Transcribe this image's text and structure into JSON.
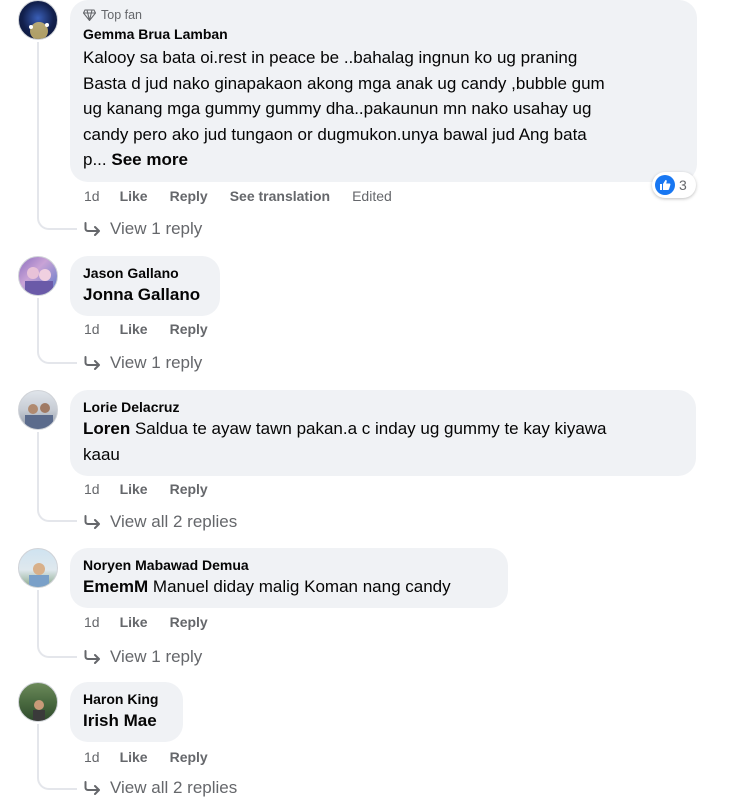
{
  "comments": [
    {
      "badge": "Top fan",
      "author": "Gemma Brua Lamban",
      "text_lines": [
        "Kalooy sa bata oi.rest in peace be ..bahalag ingnun ko ug praning",
        "Basta d jud nako ginapakaon akong mga anak ug candy ,bubble gum",
        "ug kanang mga gummy gummy dha..pakaunun mn nako usahay ug",
        "candy pero ako jud tungaon or dugmukon.unya bawal jud Ang bata"
      ],
      "text_last": "p...",
      "see_more": "See more",
      "time": "1d",
      "like": "Like",
      "reply": "Reply",
      "see_translation": "See translation",
      "edited": "Edited",
      "reaction_count": "3",
      "view_replies": "View 1 reply"
    },
    {
      "author": "Jason Gallano",
      "mention": "Jonna Gallano",
      "time": "1d",
      "like": "Like",
      "reply": "Reply",
      "view_replies": "View 1 reply"
    },
    {
      "author": "Lorie Delacruz",
      "mention": "Loren",
      "text": "Saldua te ayaw tawn pakan.a c inday ug gummy te kay kiyawa",
      "text_line2": "kaau",
      "time": "1d",
      "like": "Like",
      "reply": "Reply",
      "view_replies": "View all 2 replies"
    },
    {
      "author": "Noryen Mabawad Demua",
      "mention": "EmemM",
      "text": "Manuel diday malig Koman nang candy",
      "time": "1d",
      "like": "Like",
      "reply": "Reply",
      "view_replies": "View 1 reply"
    },
    {
      "author": "Haron King",
      "mention": "Irish Mae",
      "time": "1d",
      "like": "Like",
      "reply": "Reply",
      "view_replies": "View all 2 replies"
    }
  ],
  "colors": {
    "bubble": "#f0f2f5",
    "secondary_text": "#65676b",
    "like_blue": "#1877f2"
  }
}
